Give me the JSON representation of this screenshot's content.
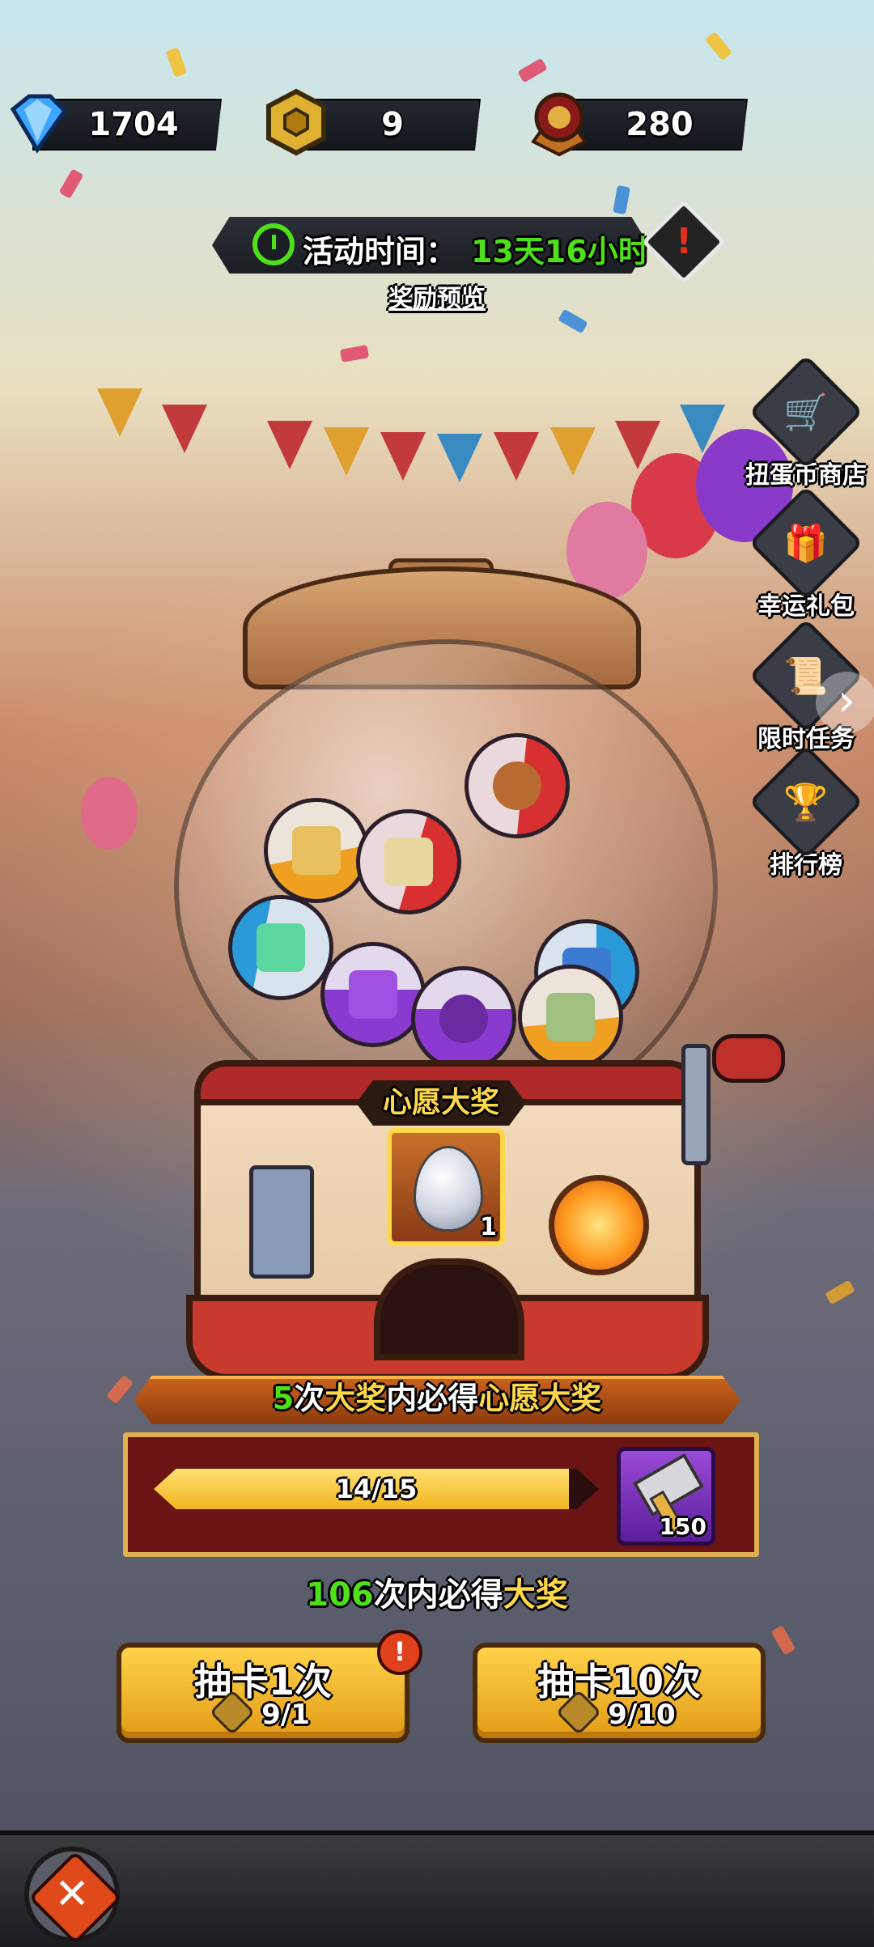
{
  "colors": {
    "green": "#4ee01a",
    "yellow": "#ffd84a",
    "white": "#ffffff"
  },
  "currencies": [
    {
      "icon": "gem-icon",
      "value": "1704"
    },
    {
      "icon": "gacha-coin-icon",
      "value": "9"
    },
    {
      "icon": "medal-icon",
      "value": "280"
    }
  ],
  "event": {
    "time_label": "活动时间：",
    "time_value": "13天16小时",
    "reward_preview": "奖励预览"
  },
  "side_menu": [
    {
      "icon": "cart-icon",
      "label": "扭蛋币商店"
    },
    {
      "icon": "gift-icon",
      "label": "幸运礼包"
    },
    {
      "icon": "scroll-icon",
      "label": "限时任务"
    },
    {
      "icon": "podium-icon",
      "label": "排行榜"
    }
  ],
  "wish": {
    "label": "心愿大奖",
    "count": "1"
  },
  "pity_banner": {
    "number": "5",
    "part1": "次",
    "highlight1": "大奖",
    "part2": "内必得",
    "highlight2": "心愿大奖"
  },
  "progress": {
    "text": "14/15",
    "fraction": 0.933,
    "reward_count": "150"
  },
  "guarantee": {
    "number": "106",
    "part1": "次内必得",
    "highlight": "大奖"
  },
  "draw_buttons": [
    {
      "label": "抽卡1次",
      "cost": "9/1"
    },
    {
      "label": "抽卡10次",
      "cost": "9/10"
    }
  ]
}
